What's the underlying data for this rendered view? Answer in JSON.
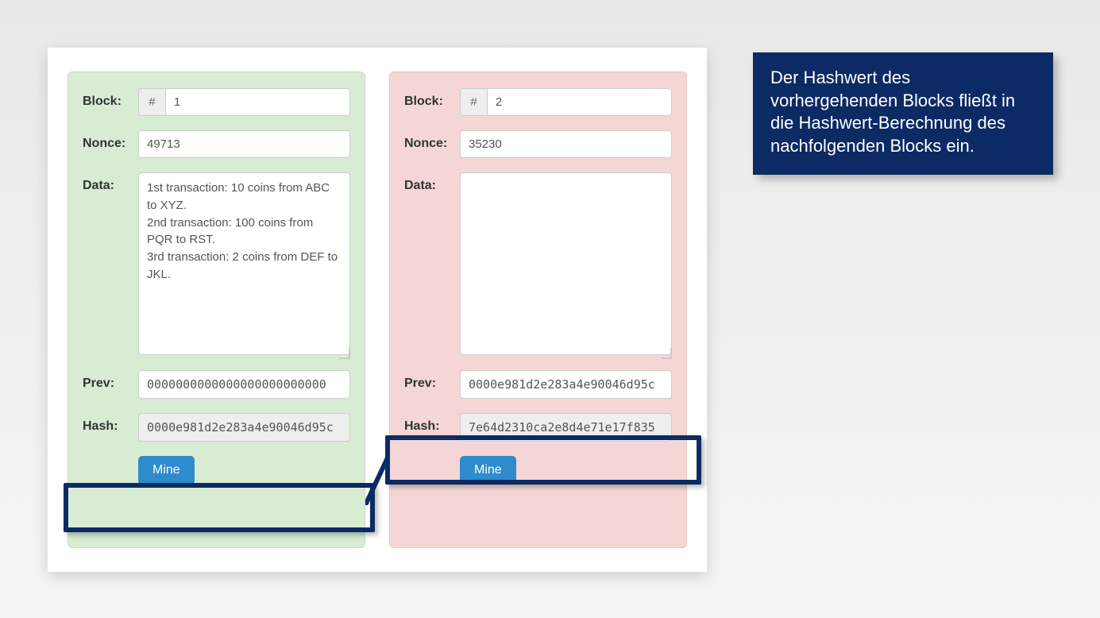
{
  "labels": {
    "block": "Block:",
    "nonce": "Nonce:",
    "data": "Data:",
    "prev": "Prev:",
    "hash": "Hash:",
    "hash_symbol": "#",
    "mine": "Mine"
  },
  "blocks": [
    {
      "number": "1",
      "nonce": "49713",
      "data": "1st transaction: 10 coins from ABC to XYZ.\n2nd transaction: 100 coins from PQR to RST.\n3rd transaction: 2 coins from DEF to JKL.",
      "prev": "0000000000000000000000000",
      "hash": "0000e981d2e283a4e90046d95c",
      "status": "valid"
    },
    {
      "number": "2",
      "nonce": "35230",
      "data": "",
      "prev": "0000e981d2e283a4e90046d95c",
      "hash": "7e64d2310ca2e8d4e71e17f835",
      "status": "invalid"
    }
  ],
  "callout": "Der Hashwert des vorhergehenden Blocks fließt in die Hashwert-Berechnung des nachfolgenden Blocks ein."
}
